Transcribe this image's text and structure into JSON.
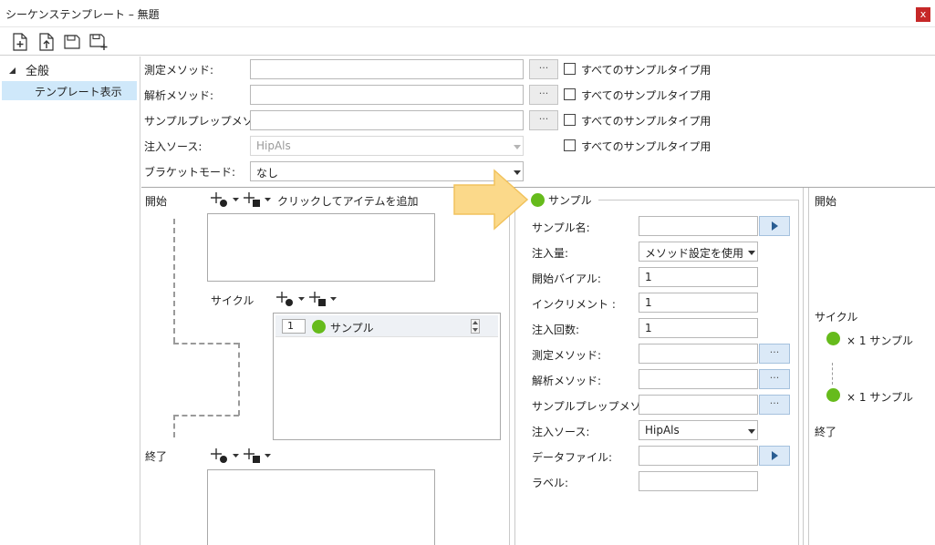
{
  "window": {
    "title": "シーケンステンプレート – 無題",
    "close_label": "x"
  },
  "toolbar": {
    "icons": [
      "new-file-icon",
      "open-file-icon",
      "save-icon",
      "save-as-icon"
    ]
  },
  "sidebar": {
    "root_label": "全般",
    "selected_label": "テンプレート表示"
  },
  "top_form": {
    "measure_method_label": "測定メソッド:",
    "analysis_method_label": "解析メソッド:",
    "prep_method_label": "サンプルプレップメソッド:",
    "inj_source_label": "注入ソース:",
    "inj_source_value": "HipAls",
    "bracket_mode_label": "ブラケットモード:",
    "bracket_mode_value": "なし",
    "all_types_label": "すべてのサンプルタイプ用",
    "dots_label": "···"
  },
  "sequence": {
    "start_label": "開始",
    "add_item_label": "クリックしてアイテムを追加",
    "cycle_label": "サイクル",
    "end_label": "終了",
    "cycle_item": {
      "index": "1",
      "name": "サンプル"
    }
  },
  "props": {
    "group_label": "サンプル",
    "sample_name_label": "サンプル名:",
    "inj_volume_label": "注入量:",
    "inj_volume_value": "メソッド設定を使用",
    "start_vial_label": "開始バイアル:",
    "start_vial_value": "1",
    "increment_label": "インクリメント :",
    "increment_value": "1",
    "inj_count_label": "注入回数:",
    "inj_count_value": "1",
    "measure_method_label": "測定メソッド:",
    "analysis_method_label": "解析メソッド:",
    "prep_method_label": "サンプルプレップメソッド:",
    "inj_source_label": "注入ソース:",
    "inj_source_value": "HipAls",
    "data_file_label": "データファイル:",
    "label_label": "ラベル:"
  },
  "preview": {
    "start_label": "開始",
    "cycle_label": "サイクル",
    "item1": "× 1  サンプル",
    "item2": "× 1  サンプル",
    "end_label": "終了"
  },
  "colors": {
    "sample_dot": "#66bb1c",
    "selection": "#cfe8fa",
    "callout_arrow": "#fbd98a"
  }
}
